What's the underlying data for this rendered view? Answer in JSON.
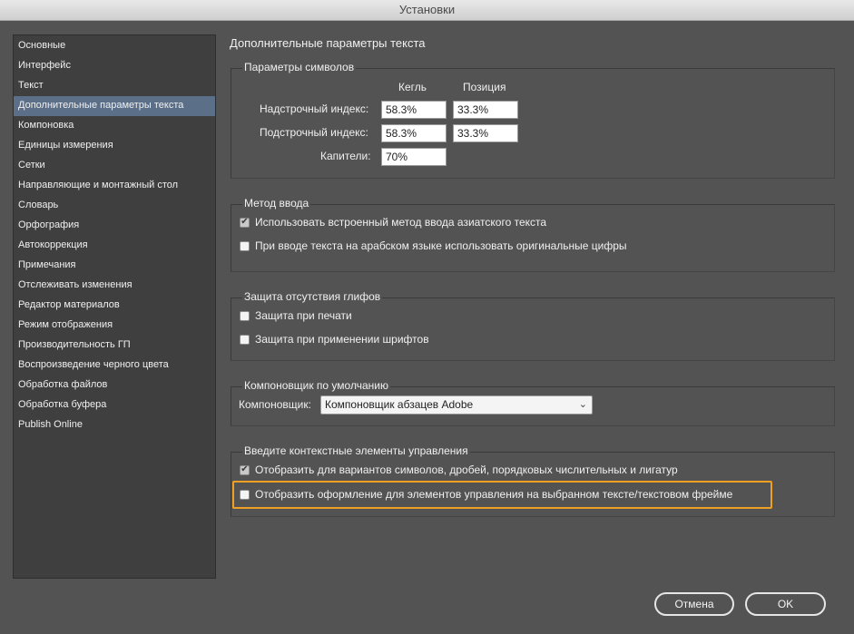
{
  "window": {
    "title": "Установки"
  },
  "sidebar": {
    "items": [
      {
        "label": "Основные"
      },
      {
        "label": "Интерфейс"
      },
      {
        "label": "Текст"
      },
      {
        "label": "Дополнительные параметры текста",
        "selected": true
      },
      {
        "label": "Компоновка"
      },
      {
        "label": "Единицы измерения"
      },
      {
        "label": "Сетки"
      },
      {
        "label": "Направляющие и монтажный стол"
      },
      {
        "label": "Словарь"
      },
      {
        "label": "Орфография"
      },
      {
        "label": "Автокоррекция"
      },
      {
        "label": "Примечания"
      },
      {
        "label": "Отслеживать изменения"
      },
      {
        "label": "Редактор материалов"
      },
      {
        "label": "Режим отображения"
      },
      {
        "label": "Производительность ГП"
      },
      {
        "label": "Воспроизведение черного цвета"
      },
      {
        "label": "Обработка файлов"
      },
      {
        "label": "Обработка буфера"
      },
      {
        "label": "Publish Online"
      }
    ]
  },
  "main": {
    "title": "Дополнительные параметры текста",
    "char_settings": {
      "title": "Параметры символов",
      "col_size": "Кегль",
      "col_position": "Позиция",
      "superscript_label": "Надстрочный индекс:",
      "superscript_size": "58.3%",
      "superscript_position": "33.3%",
      "subscript_label": "Подстрочный индекс:",
      "subscript_size": "58.3%",
      "subscript_position": "33.3%",
      "smallcaps_label": "Капители:",
      "smallcaps_size": "70%"
    },
    "input_method": {
      "title": "Метод ввода",
      "opt1_label": "Использовать встроенный метод ввода азиатского текста",
      "opt1_checked": true,
      "opt2_label": "При вводе текста на арабском языке использовать оригинальные цифры",
      "opt2_checked": false
    },
    "missing_glyph": {
      "title": "Защита отсутствия глифов",
      "opt1_label": "Защита при печати",
      "opt1_checked": false,
      "opt2_label": "Защита при применении шрифтов",
      "opt2_checked": false
    },
    "composer": {
      "title": "Компоновщик по умолчанию",
      "label": "Компоновщик:",
      "value": "Компоновщик абзацев Adobe"
    },
    "contextual": {
      "title": "Введите контекстные элементы управления",
      "opt1_label": "Отобразить для вариантов символов, дробей, порядковых числительных и лигатур",
      "opt1_checked": true,
      "opt2_label": "Отобразить оформление для элементов управления на выбранном тексте/текстовом фрейме",
      "opt2_checked": false
    }
  },
  "footer": {
    "cancel_label": "Отмена",
    "ok_label": "OK"
  },
  "colors": {
    "background": "#535353",
    "sidebar_selected": "#5b6f88",
    "highlight": "#f0a020"
  },
  "icons": {
    "checkmark": "check-icon",
    "dropdown": "chevron-down-icon"
  }
}
